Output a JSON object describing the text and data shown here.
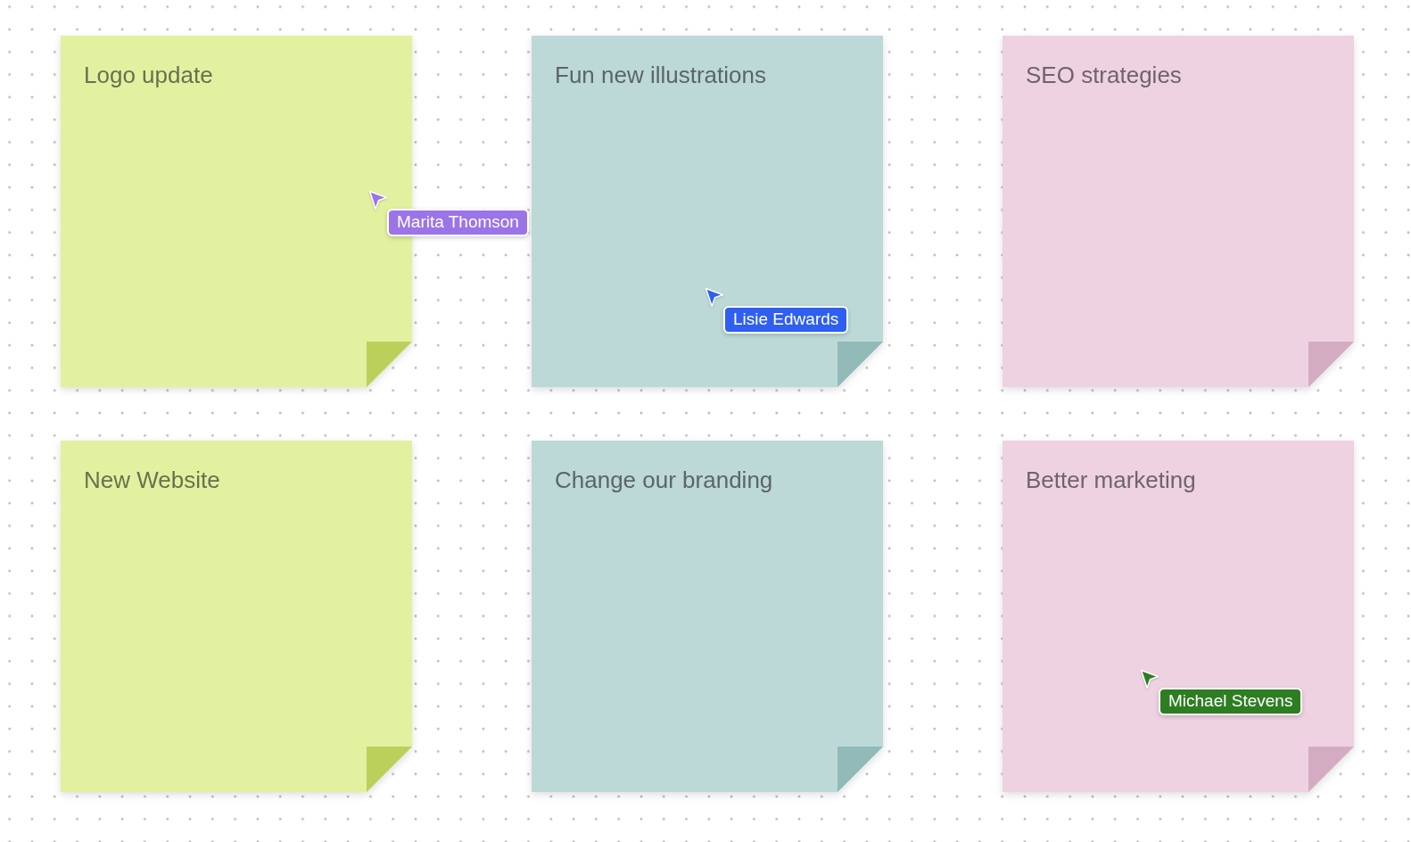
{
  "notes": [
    {
      "title": "Logo update",
      "color": "#e2f19f"
    },
    {
      "title": "Fun new illustrations",
      "color": "#bcd9d8"
    },
    {
      "title": "SEO strategies",
      "color": "#eed2e1"
    },
    {
      "title": "New Website",
      "color": "#e2f19f"
    },
    {
      "title": "Change our branding",
      "color": "#bcd9d8"
    },
    {
      "title": "Better marketing",
      "color": "#eed2e1"
    }
  ],
  "cursors": [
    {
      "name": "Marita Thomson",
      "color": "#9b74e8"
    },
    {
      "name": "Lisie Edwards",
      "color": "#2f5ff0"
    },
    {
      "name": "Michael Stevens",
      "color": "#2e7d22"
    }
  ]
}
